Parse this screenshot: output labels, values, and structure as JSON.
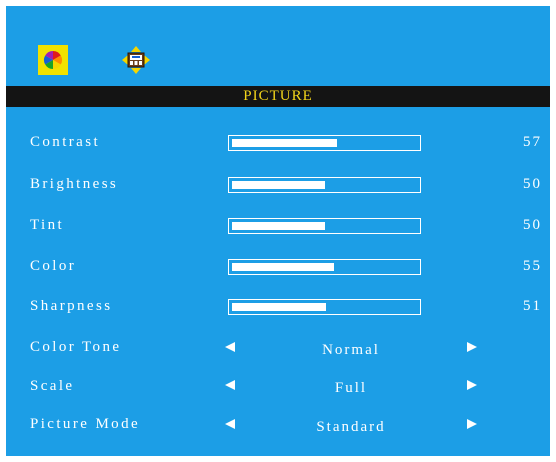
{
  "tabs": [
    {
      "name": "picture",
      "icon": "color-wheel-icon",
      "active": true
    },
    {
      "name": "setup",
      "icon": "setup-icon",
      "active": false
    }
  ],
  "title": "PICTURE",
  "sliders": [
    {
      "label": "Contrast",
      "value": 57
    },
    {
      "label": "Brightness",
      "value": 50
    },
    {
      "label": "Tint",
      "value": 50
    },
    {
      "label": "Color",
      "value": 55
    },
    {
      "label": "Sharpness",
      "value": 51
    }
  ],
  "options": [
    {
      "label": "Color Tone",
      "value": "Normal"
    },
    {
      "label": "Scale",
      "value": "Full"
    },
    {
      "label": "Picture Mode",
      "value": "Standard"
    }
  ],
  "colors": {
    "background": "#1c9ee6",
    "title_bar": "#141414",
    "title_text": "#f3d51a",
    "active_tab": "#f1e200"
  }
}
